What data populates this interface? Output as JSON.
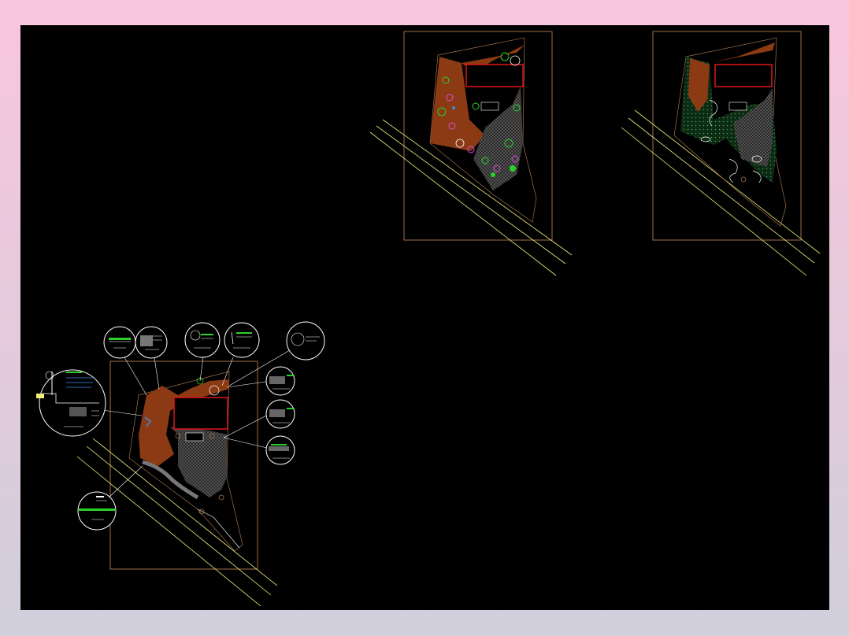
{
  "viewer": {
    "background_color": "#000000",
    "frame_gradient": [
      "#f9c6df",
      "#d0cfdc"
    ]
  },
  "colors": {
    "border": "#a0704a",
    "road": "#f2f07a",
    "building": "#e0151b",
    "path_brown": "#8b3a14",
    "plaza_gray": "#5a5a5a",
    "plant_green": "#2bd12b",
    "flower_magenta": "#e04de0",
    "water_blue": "#3a8fe0",
    "outline_white": "#ffffff"
  },
  "drawings": [
    {
      "id": "detail-index-plan",
      "icon": "site-plan-with-detail-callouts"
    },
    {
      "id": "planting-plan",
      "icon": "site-plan-planting"
    },
    {
      "id": "layout-plan",
      "icon": "site-plan-layout"
    }
  ]
}
